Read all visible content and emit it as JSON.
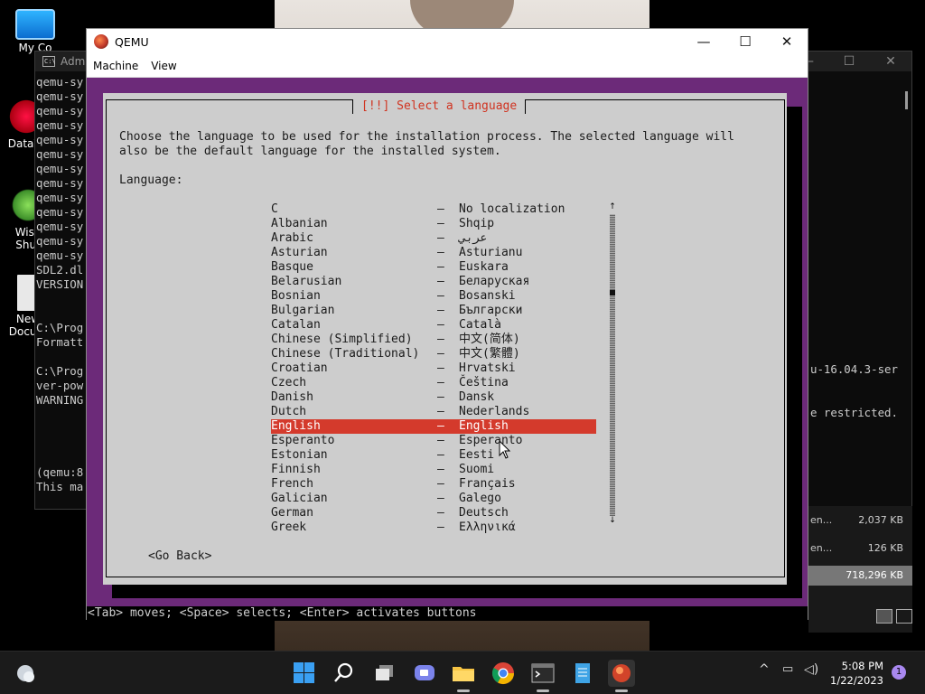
{
  "desktop": {
    "icons": [
      {
        "label": "My Co"
      },
      {
        "label": "DataW"
      },
      {
        "label": "Wise\nShut"
      },
      {
        "label": "New\nDocum"
      }
    ]
  },
  "console": {
    "title": "Adm",
    "lines": "qemu-sy\nqemu-sy\nqemu-sy\nqemu-sy\nqemu-sy\nqemu-sy\nqemu-sy\nqemu-sy\nqemu-sy\nqemu-sy\nqemu-sy\nqemu-sy\nqemu-sy\nSDL2.dl\nVERSION\n\n\nC:\\Prog\nFormatt\n\nC:\\Prog\nver-pow\nWARNING\n\n\n\n\n(qemu:8\nThis ma",
    "right_lines": "u-16.04.3-ser\n\n\ne restricted.",
    "controls": {
      "minimize": "—",
      "maximize": "☐",
      "close": "✕"
    }
  },
  "explorer": {
    "rows": [
      {
        "name": "en...",
        "size": "2,037 KB"
      },
      {
        "name": "en...",
        "size": "126 KB"
      },
      {
        "name": "",
        "size": "718,296 KB"
      }
    ]
  },
  "qemu": {
    "title": "QEMU",
    "menu": [
      "Machine",
      "View"
    ],
    "controls": {
      "minimize": "—",
      "maximize": "☐",
      "close": "✕"
    },
    "installer": {
      "title": "[!!] Select a language",
      "description": "Choose the language to be used for the installation process. The selected language will\nalso be the default language for the installed system.",
      "language_label": "Language:",
      "separator": "–",
      "languages": [
        {
          "name": "C",
          "native": "No localization"
        },
        {
          "name": "Albanian",
          "native": "Shqip"
        },
        {
          "name": "Arabic",
          "native": "عربي"
        },
        {
          "name": "Asturian",
          "native": "Asturianu"
        },
        {
          "name": "Basque",
          "native": "Euskara"
        },
        {
          "name": "Belarusian",
          "native": "Беларуская"
        },
        {
          "name": "Bosnian",
          "native": "Bosanski"
        },
        {
          "name": "Bulgarian",
          "native": "Български"
        },
        {
          "name": "Catalan",
          "native": "Català"
        },
        {
          "name": "Chinese (Simplified)",
          "native": "中文(简体)"
        },
        {
          "name": "Chinese (Traditional)",
          "native": "中文(繁體)"
        },
        {
          "name": "Croatian",
          "native": "Hrvatski"
        },
        {
          "name": "Czech",
          "native": "Čeština"
        },
        {
          "name": "Danish",
          "native": "Dansk"
        },
        {
          "name": "Dutch",
          "native": "Nederlands"
        },
        {
          "name": "English",
          "native": "English"
        },
        {
          "name": "Esperanto",
          "native": "Esperanto"
        },
        {
          "name": "Estonian",
          "native": "Eesti"
        },
        {
          "name": "Finnish",
          "native": "Suomi"
        },
        {
          "name": "French",
          "native": "Français"
        },
        {
          "name": "Galician",
          "native": "Galego"
        },
        {
          "name": "German",
          "native": "Deutsch"
        },
        {
          "name": "Greek",
          "native": "Ελληνικά"
        }
      ],
      "selected_language": "English",
      "scroll_up": "↑",
      "scroll_down": "↓",
      "go_back": "<Go Back>",
      "help_line": "<Tab> moves; <Space> selects; <Enter> activates buttons"
    }
  },
  "taskbar": {
    "time": "5:08 PM",
    "date": "1/22/2023",
    "notification_count": "1",
    "apps": [
      "start",
      "search",
      "task-view",
      "chat",
      "file-explorer",
      "chrome",
      "terminal",
      "notepad",
      "qemu"
    ]
  },
  "colors": {
    "vm_background": "#6c2a79",
    "dialog_background": "#cdcdcd",
    "selection": "#d43a2c",
    "title_red": "#d03320"
  }
}
